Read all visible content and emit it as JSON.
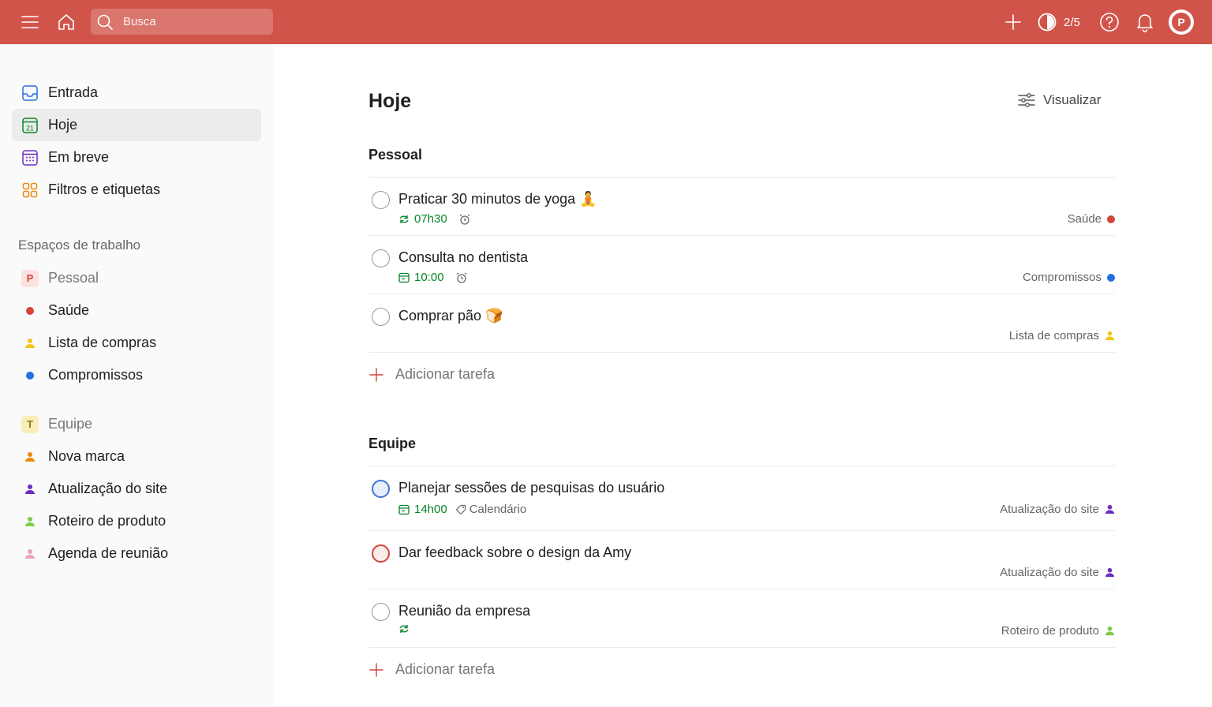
{
  "topbar": {
    "search_placeholder": "Busca",
    "karma": "2/5",
    "avatar_letter": "P",
    "icons": [
      "menu-icon",
      "home-icon",
      "search-icon",
      "plus-icon",
      "karma-icon",
      "help-icon",
      "bell-icon"
    ]
  },
  "sidebar": {
    "nav": [
      {
        "label": "Entrada",
        "icon": "inbox-icon",
        "color": "#246fe0"
      },
      {
        "label": "Hoje",
        "icon": "calendar-today-icon",
        "color": "#058527",
        "active": true,
        "day": "21"
      },
      {
        "label": "Em breve",
        "icon": "calendar-upcoming-icon",
        "color": "#692fc2"
      },
      {
        "label": "Filtros e etiquetas",
        "icon": "filters-icon",
        "color": "#eb8909"
      }
    ],
    "workspaces_title": "Espaços de trabalho",
    "personal": {
      "label": "Pessoal",
      "badge": "P",
      "projects": [
        {
          "label": "Saúde",
          "type": "dot",
          "color": "#d1453b"
        },
        {
          "label": "Lista de compras",
          "type": "person",
          "color": "#f5c518"
        },
        {
          "label": "Compromissos",
          "type": "dot",
          "color": "#246fe0"
        }
      ]
    },
    "team": {
      "label": "Equipe",
      "badge": "T",
      "projects": [
        {
          "label": "Nova marca",
          "type": "person",
          "color": "#eb8909"
        },
        {
          "label": "Atualização do site",
          "type": "person",
          "color": "#692fc2"
        },
        {
          "label": "Roteiro de produto",
          "type": "person",
          "color": "#7ecc49"
        },
        {
          "label": "Agenda de reunião",
          "type": "person",
          "color": "#e8a0bf"
        }
      ]
    }
  },
  "main": {
    "title": "Hoje",
    "view_label": "Visualizar",
    "add_task_label": "Adicionar tarefa",
    "groups": [
      {
        "title": "Pessoal",
        "tasks": [
          {
            "title": "Praticar 30 minutos de yoga 🧘",
            "time": "07h30",
            "recurring": true,
            "alarm": true,
            "project": "Saúde",
            "project_color": "#d1453b",
            "project_type": "dot"
          },
          {
            "title": "Consulta no dentista",
            "time": "10:00",
            "recurring": false,
            "alarm": true,
            "project": "Compromissos",
            "project_color": "#246fe0",
            "project_type": "dot"
          },
          {
            "title": "Comprar pão 🍞",
            "project": "Lista de compras",
            "project_color": "#f5c518",
            "project_type": "person"
          }
        ]
      },
      {
        "title": "Equipe",
        "tasks": [
          {
            "title": "Planejar sessões de pesquisas do usuário",
            "time": "14h00",
            "label": "Calendário",
            "priority": "blue",
            "project": "Atualização do site",
            "project_color": "#692fc2",
            "project_type": "person"
          },
          {
            "title": "Dar feedback sobre o design da Amy",
            "priority": "red",
            "project": "Atualização do site",
            "project_color": "#692fc2",
            "project_type": "person"
          },
          {
            "title": "Reunião da empresa",
            "recurring_only": true,
            "project": "Roteiro de produto",
            "project_color": "#7ecc49",
            "project_type": "person"
          }
        ]
      }
    ]
  }
}
